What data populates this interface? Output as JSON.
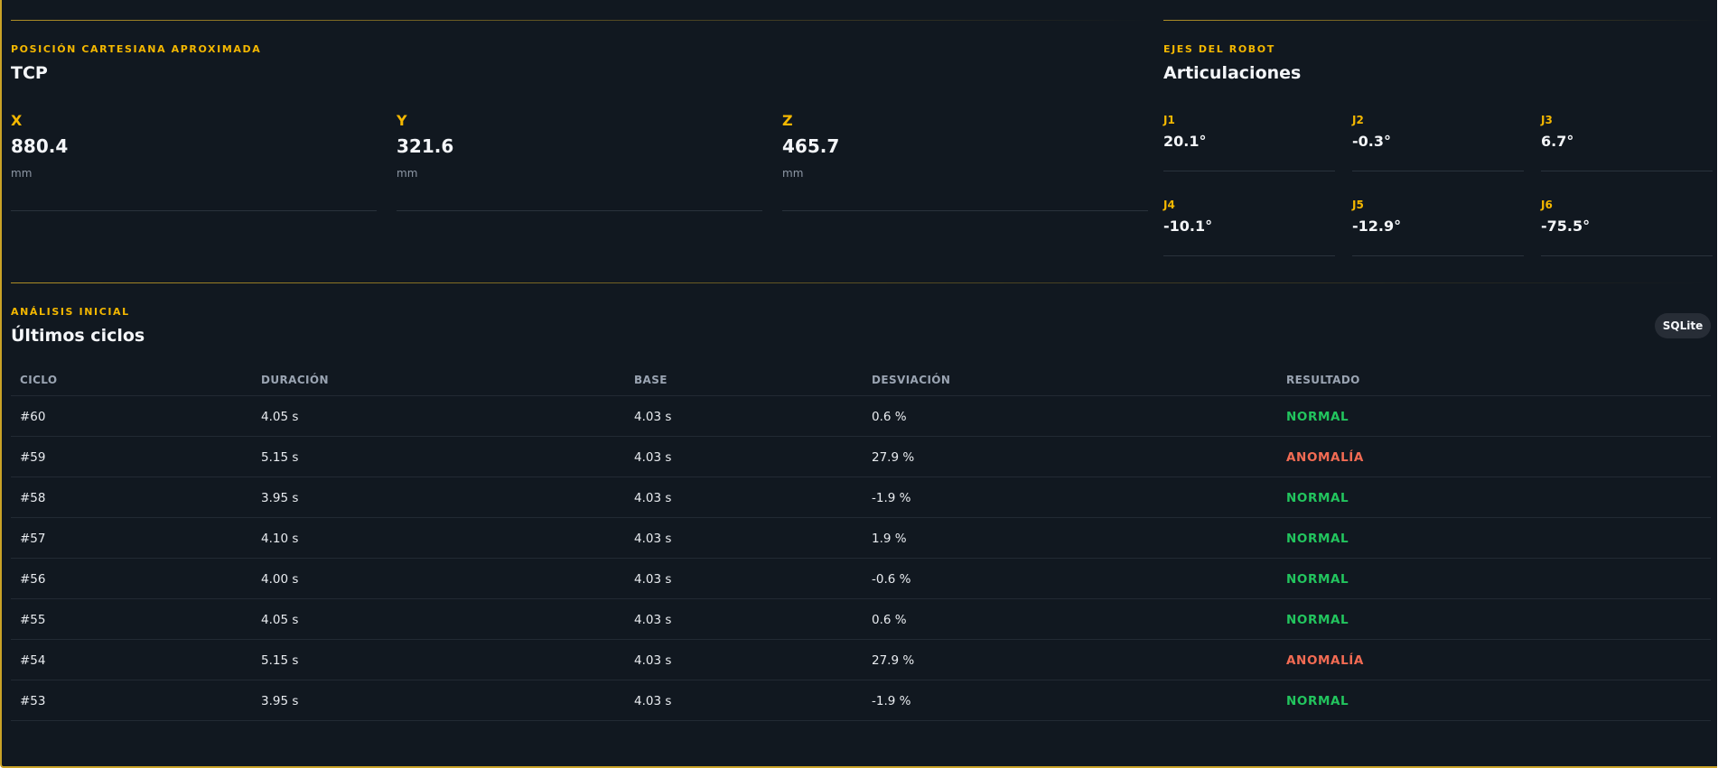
{
  "cartesian": {
    "eyebrow": "POSICIÓN CARTESIANA APROXIMADA",
    "title": "TCP",
    "metrics": [
      {
        "label": "X",
        "value": "880.4",
        "unit": "mm"
      },
      {
        "label": "Y",
        "value": "321.6",
        "unit": "mm"
      },
      {
        "label": "Z",
        "value": "465.7",
        "unit": "mm"
      }
    ]
  },
  "axes": {
    "eyebrow": "EJES DEL ROBOT",
    "title": "Articulaciones",
    "joints": [
      {
        "label": "J1",
        "value": "20.1°"
      },
      {
        "label": "J2",
        "value": "-0.3°"
      },
      {
        "label": "J3",
        "value": "6.7°"
      },
      {
        "label": "J4",
        "value": "-10.1°"
      },
      {
        "label": "J5",
        "value": "-12.9°"
      },
      {
        "label": "J6",
        "value": "-75.5°"
      }
    ]
  },
  "analysis": {
    "eyebrow": "ANÁLISIS INICIAL",
    "title": "Últimos ciclos",
    "badge": "SQLite",
    "columns": [
      "CICLO",
      "DURACIÓN",
      "BASE",
      "DESVIACIÓN",
      "RESULTADO"
    ],
    "rows": [
      {
        "cycle": "#60",
        "duration": "4.05 s",
        "base": "4.03 s",
        "deviation": "0.6 %",
        "result": "NORMAL"
      },
      {
        "cycle": "#59",
        "duration": "5.15 s",
        "base": "4.03 s",
        "deviation": "27.9 %",
        "result": "ANOMALÍA"
      },
      {
        "cycle": "#58",
        "duration": "3.95 s",
        "base": "4.03 s",
        "deviation": "-1.9 %",
        "result": "NORMAL"
      },
      {
        "cycle": "#57",
        "duration": "4.10 s",
        "base": "4.03 s",
        "deviation": "1.9 %",
        "result": "NORMAL"
      },
      {
        "cycle": "#56",
        "duration": "4.00 s",
        "base": "4.03 s",
        "deviation": "-0.6 %",
        "result": "NORMAL"
      },
      {
        "cycle": "#55",
        "duration": "4.05 s",
        "base": "4.03 s",
        "deviation": "0.6 %",
        "result": "NORMAL"
      },
      {
        "cycle": "#54",
        "duration": "5.15 s",
        "base": "4.03 s",
        "deviation": "27.9 %",
        "result": "ANOMALÍA"
      },
      {
        "cycle": "#53",
        "duration": "3.95 s",
        "base": "4.03 s",
        "deviation": "-1.9 %",
        "result": "NORMAL"
      }
    ]
  },
  "colors": {
    "accent": "#f5b800",
    "normal": "#22c55e",
    "anomaly": "#f26b53",
    "background": "#111820"
  }
}
